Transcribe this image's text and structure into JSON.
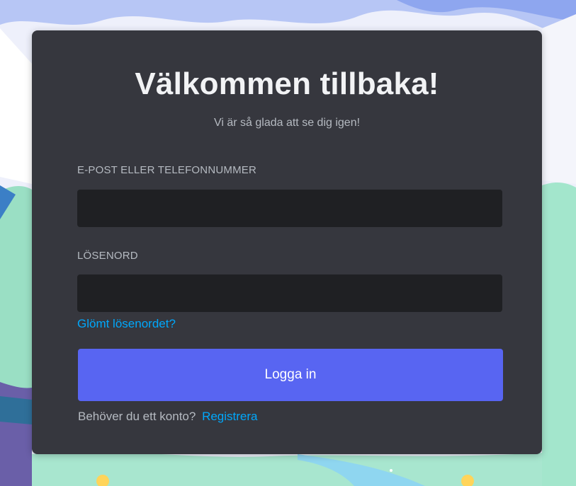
{
  "login": {
    "title": "Välkommen tillbaka!",
    "subtitle": "Vi är så glada att se dig igen!",
    "email_label": "E-POST ELLER TELEFONNUMMER",
    "email_value": "",
    "password_label": "LÖSENORD",
    "password_value": "",
    "forgot_link": "Glömt lösenordet?",
    "login_button": "Logga in",
    "register_prompt": "Behöver du ett konto?",
    "register_link": "Registrera"
  },
  "colors": {
    "card_bg": "#36373e",
    "input_bg": "#1f2023",
    "accent": "#5865f2",
    "link": "#00a8fc",
    "muted_text": "#b5bac1"
  }
}
